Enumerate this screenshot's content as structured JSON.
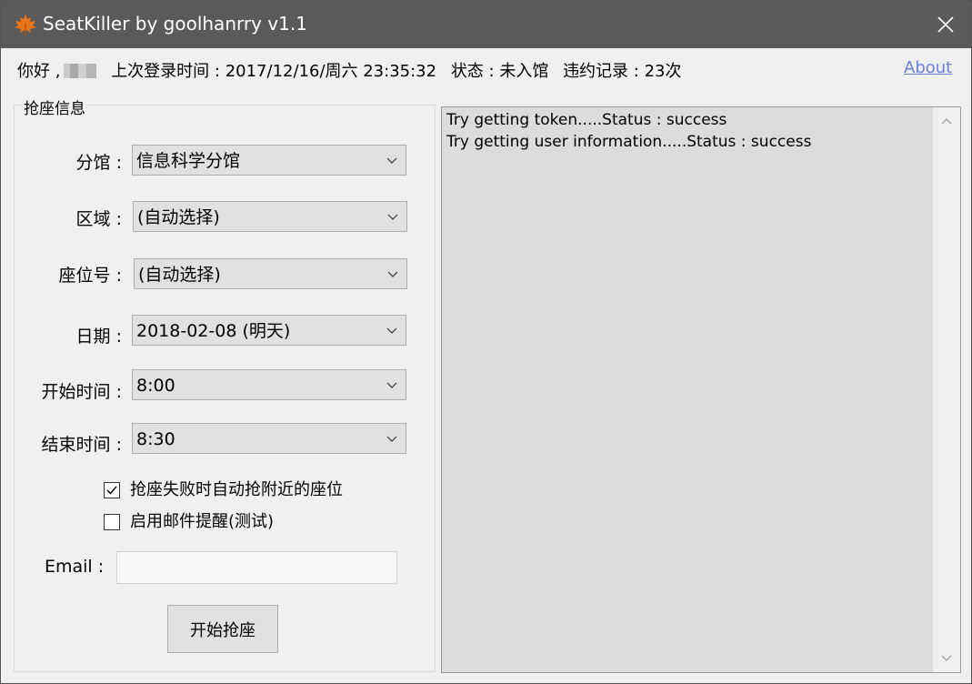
{
  "window": {
    "title": "SeatKiller by goolhanrry v1.1",
    "icon": "maple-leaf-icon",
    "accent_color": "#e8751a"
  },
  "infobar": {
    "greeting": "你好 ,",
    "last_login": "上次登录时间 : 2017/12/16/周六 23:35:32",
    "status": "状态 : 未入馆",
    "violations": "违约记录 : 23次",
    "about_label": "About"
  },
  "form": {
    "group_title": "抢座信息",
    "branch": {
      "label": "分馆 :",
      "value": "信息科学分馆"
    },
    "area": {
      "label": "区域 :",
      "value": "(自动选择)"
    },
    "seat": {
      "label": "座位号 :",
      "value": "(自动选择)"
    },
    "date": {
      "label": "日期 :",
      "value": "2018-02-08 (明天)"
    },
    "start_time": {
      "label": "开始时间 :",
      "value": "8:00"
    },
    "end_time": {
      "label": "结束时间 :",
      "value": "8:30"
    },
    "auto_nearby": {
      "label": "抢座失败时自动抢附近的座位",
      "checked": true
    },
    "email_notify": {
      "label": "启用邮件提醒(测试)",
      "checked": false
    },
    "email_label": "Email :",
    "email_value": "",
    "start_button": "开始抢座"
  },
  "log": {
    "lines": [
      "Try getting token.....Status : success",
      "Try getting user information.....Status : success"
    ]
  }
}
